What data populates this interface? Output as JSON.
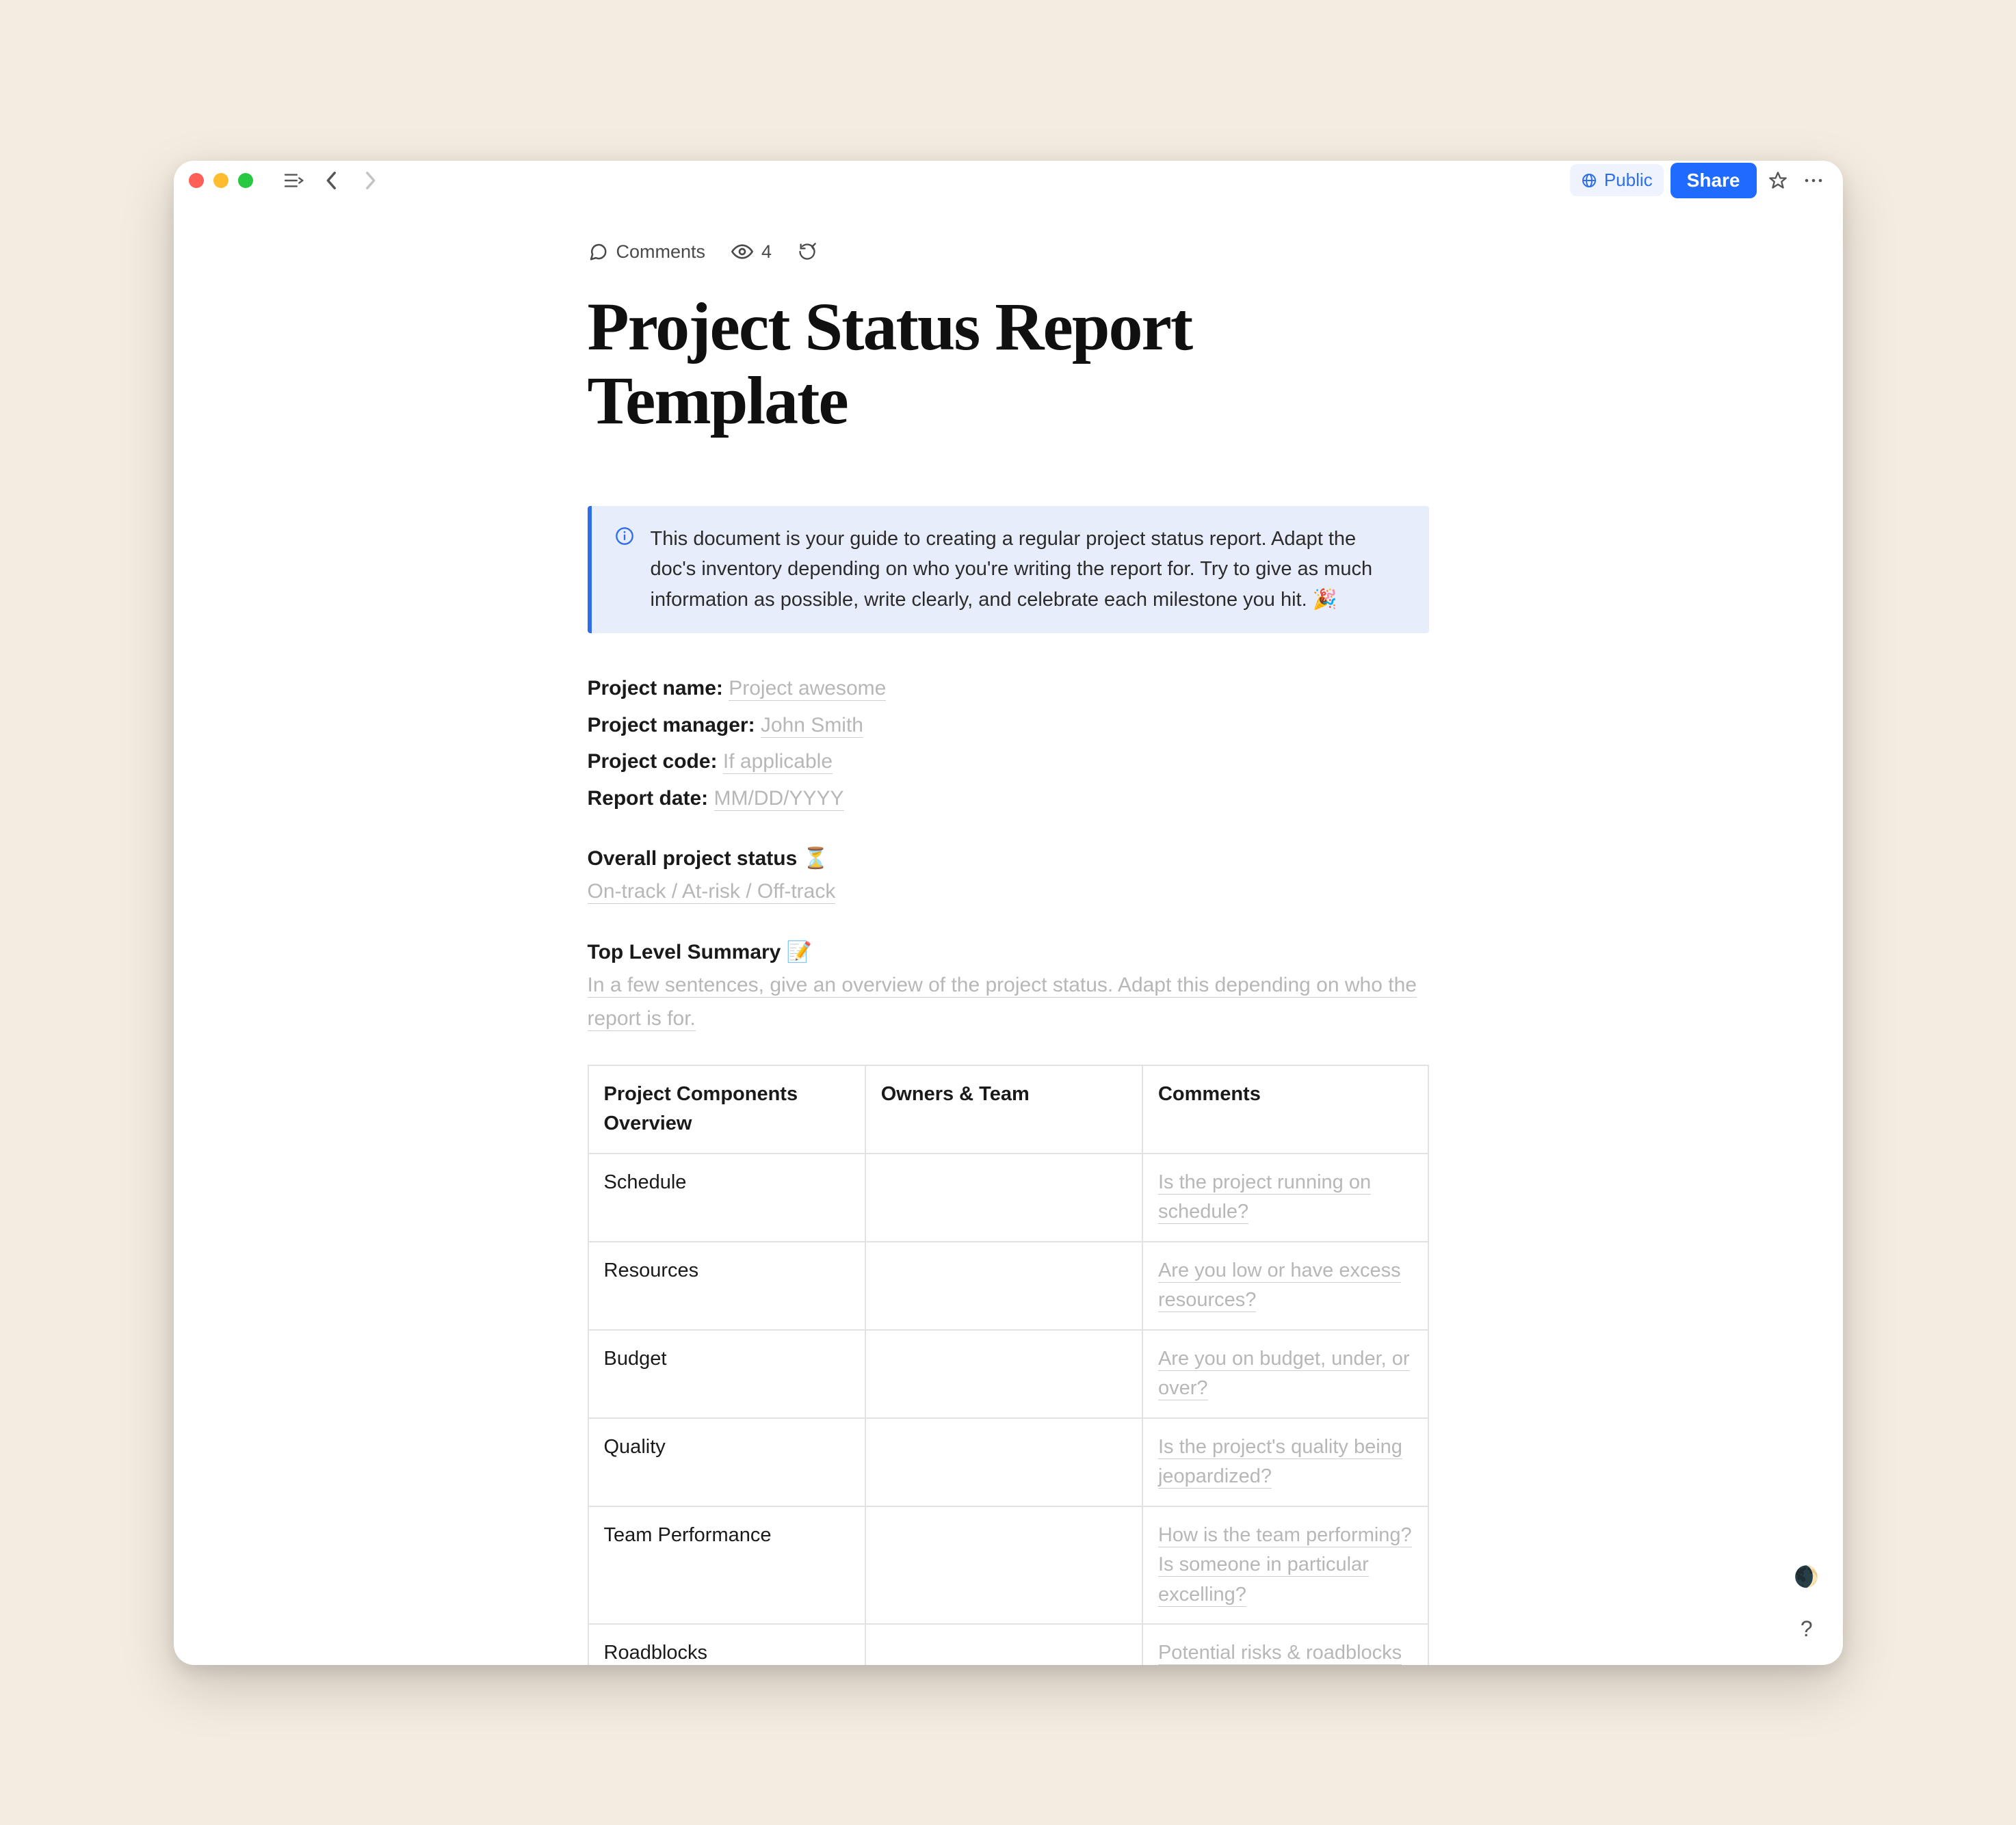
{
  "toolbar": {
    "public_label": "Public",
    "share_label": "Share"
  },
  "meta": {
    "comments_label": "Comments",
    "view_count": "4"
  },
  "title": "Project Status Report Template",
  "callout": {
    "text": "This document is your guide to creating a regular project status report. Adapt the doc's inventory depending on who you're writing the report for. Try to give as much information as possible, write clearly, and celebrate each milestone you hit. 🎉"
  },
  "fields": {
    "project_name_label": "Project name: ",
    "project_name_ph": "Project awesome ",
    "project_manager_label": "Project manager: ",
    "project_manager_ph": "John Smith",
    "project_code_label": "Project code: ",
    "project_code_ph": "If applicable",
    "report_date_label": "Report date: ",
    "report_date_ph": "MM/DD/YYYY"
  },
  "status": {
    "heading": "Overall project status ⏳",
    "placeholder": "On-track / At-risk / Off-track"
  },
  "summary": {
    "heading": "Top Level Summary 📝",
    "placeholder": "In a few sentences, give an overview of the project status. Adapt this depending on who the report is for. "
  },
  "table": {
    "headers": [
      "Project Components Overview",
      "Owners & Team",
      "Comments"
    ],
    "rows": [
      {
        "c0": "Schedule",
        "c1": "",
        "c2": "Is the project running on schedule?"
      },
      {
        "c0": "Resources",
        "c1": "",
        "c2": "Are you low or have excess resources?"
      },
      {
        "c0": "Budget",
        "c1": "",
        "c2": "Are you on budget, under, or over? "
      },
      {
        "c0": "Quality",
        "c1": "",
        "c2": "Is the project's quality being jeopardized? "
      },
      {
        "c0": "Team Performance",
        "c1": "",
        "c2": "How is the team performing? Is someone in particular excelling?"
      },
      {
        "c0": "Roadblocks",
        "c1": "",
        "c2": "Potential risks & roadblocks"
      }
    ]
  }
}
